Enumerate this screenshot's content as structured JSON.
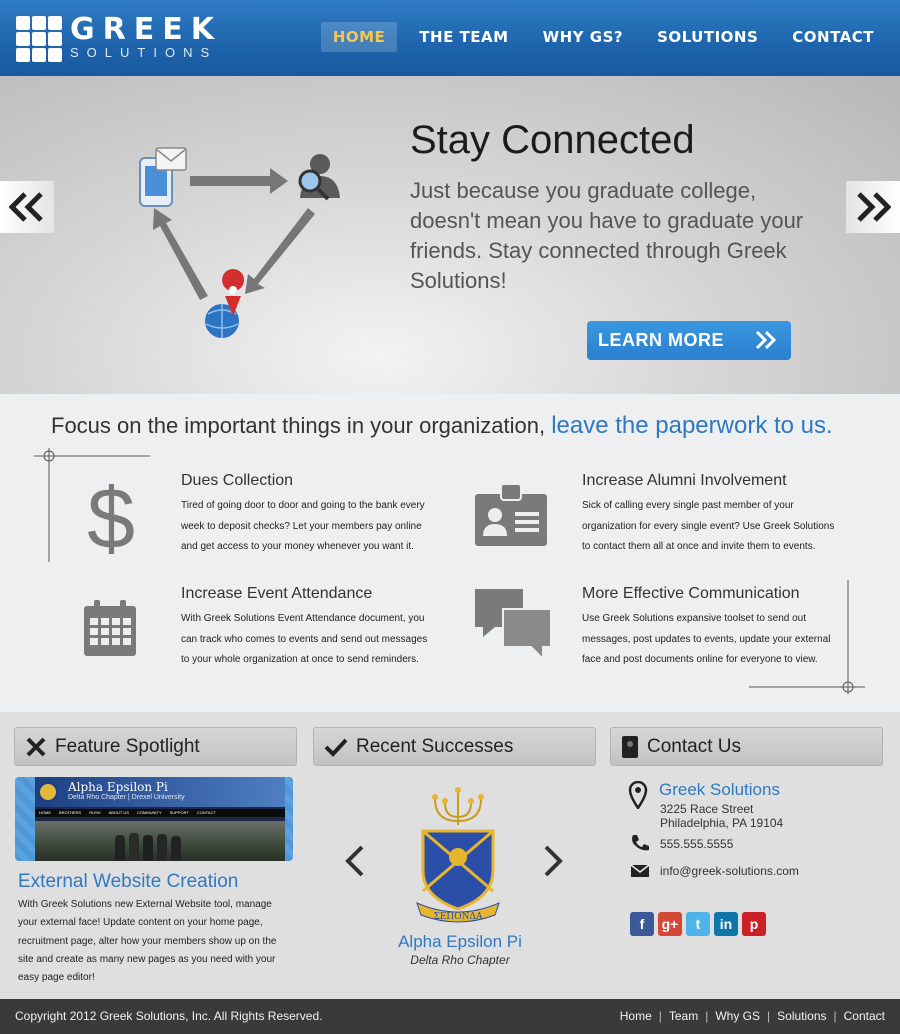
{
  "brand": {
    "name_top": "GREEK",
    "name_bottom": "SOLUTIONS"
  },
  "nav": [
    {
      "label": "HOME",
      "active": true
    },
    {
      "label": "THE TEAM",
      "active": false
    },
    {
      "label": "WHY GS?",
      "active": false
    },
    {
      "label": "SOLUTIONS",
      "active": false
    },
    {
      "label": "CONTACT",
      "active": false
    }
  ],
  "hero": {
    "title": "Stay Connected",
    "text": "Just because you graduate college, doesn't mean you have to graduate your friends.  Stay connected through Greek Solutions!",
    "button": "LEARN MORE"
  },
  "focus": {
    "lead": "Focus on the important things in your organization,",
    "accent": "leave the paperwork to us."
  },
  "features": [
    {
      "title": "Dues Collection",
      "text": "Tired of going door to door and going to the bank every week to deposit checks?  Let your members pay online and get access to your money whenever you want it.",
      "icon": "dollar-icon"
    },
    {
      "title": "Increase Alumni Involvement",
      "text": "Sick of calling every single past member of your organization for every single event?  Use Greek Solutions to contact them all at once and invite them to events.",
      "icon": "id-badge-icon"
    },
    {
      "title": "Increase Event Attendance",
      "text": "With Greek Solutions Event Attendance document, you can track who comes to events and send out messages to your whole organization at once to send reminders.",
      "icon": "calendar-icon"
    },
    {
      "title": "More Effective Communication",
      "text": "Use Greek Solutions expansive toolset to send out messages, post updates to events, update your external face and post documents online for everyone to view.",
      "icon": "chat-bubbles-icon"
    }
  ],
  "spotlight": {
    "heading": "Feature Spotlight",
    "thumb_title": "Alpha Epsilon Pi",
    "thumb_sub": "Delta Rho Chapter | Drexel University",
    "thumb_nav": [
      "HOME",
      "BROTHERS",
      "RUSH",
      "ABOUT US",
      "COMMUNITY",
      "SUPPORT",
      "CONTACT"
    ],
    "title": "External Website Creation",
    "text": "With Greek Solutions new External Website tool, manage your external face!  Update content on your home page, recruitment page, alter how your members show up on the site and create as many new pages as you need with your easy page editor!"
  },
  "successes": {
    "heading": "Recent Successes",
    "name": "Alpha Epsilon Pi",
    "sub": "Delta Rho Chapter",
    "crest_banner": "ΣΕΠΟΝΔΑ"
  },
  "contact": {
    "heading": "Contact Us",
    "name": "Greek Solutions",
    "street": "3225 Race Street",
    "city": "Philadelphia, PA 19104",
    "phone": "555.555.5555",
    "email": "info@greek-solutions.com",
    "social": [
      {
        "icon": "facebook-icon",
        "glyph": "f",
        "color": "#3b5998"
      },
      {
        "icon": "google-plus-icon",
        "glyph": "g+",
        "color": "#d34836"
      },
      {
        "icon": "twitter-icon",
        "glyph": "t",
        "color": "#4fb3e8"
      },
      {
        "icon": "linkedin-icon",
        "glyph": "in",
        "color": "#0e76a8"
      },
      {
        "icon": "pinterest-icon",
        "glyph": "p",
        "color": "#cb2027"
      }
    ]
  },
  "footer": {
    "copyright": "Copyright 2012 Greek Solutions, Inc.  All Rights Reserved.",
    "links": [
      "Home",
      "Team",
      "Why GS",
      "Solutions",
      "Contact"
    ]
  },
  "colors": {
    "brand_blue": "#1f66ae",
    "accent_blue": "#2f79c2",
    "nav_active": "#f2c94c",
    "footer": "#3a3a3b"
  }
}
